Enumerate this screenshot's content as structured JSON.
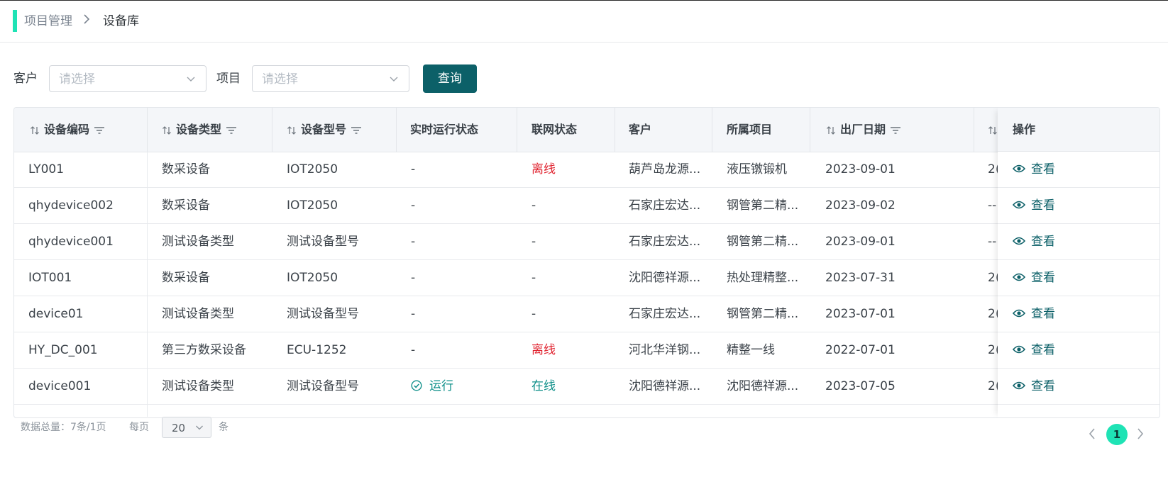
{
  "breadcrumb": {
    "parent": "项目管理",
    "separator": "›",
    "current": "设备库"
  },
  "filters": {
    "customer_label": "客户",
    "customer_placeholder": "请选择",
    "project_label": "项目",
    "project_placeholder": "请选择",
    "query_button": "查询"
  },
  "table": {
    "headers": {
      "code": "设备编码",
      "type": "设备类型",
      "model": "设备型号",
      "run_status": "实时运行状态",
      "net_status": "联网状态",
      "customer": "客户",
      "project": "所属项目",
      "factory_date": "出厂日期",
      "actions": "操作"
    },
    "view_label": "查看",
    "rows": [
      {
        "code": "LY001",
        "type": "数采设备",
        "model": "IOT2050",
        "run": "-",
        "net": "离线",
        "customer": "葫芦岛龙源...",
        "project": "液压镦锻机",
        "date": "2023-09-01",
        "extra": "2("
      },
      {
        "code": "qhydevice002",
        "type": "数采设备",
        "model": "IOT2050",
        "run": "-",
        "net": "-",
        "customer": "石家庄宏达...",
        "project": "钢管第二精...",
        "date": "2023-09-02",
        "extra": "--"
      },
      {
        "code": "qhydevice001",
        "type": "测试设备类型",
        "model": "测试设备型号",
        "run": "-",
        "net": "-",
        "customer": "石家庄宏达...",
        "project": "钢管第二精...",
        "date": "2023-09-01",
        "extra": "--"
      },
      {
        "code": "IOT001",
        "type": "数采设备",
        "model": "IOT2050",
        "run": "-",
        "net": "-",
        "customer": "沈阳德祥源...",
        "project": "热处理精整...",
        "date": "2023-07-31",
        "extra": "2("
      },
      {
        "code": "device01",
        "type": "测试设备类型",
        "model": "测试设备型号",
        "run": "-",
        "net": "-",
        "customer": "石家庄宏达...",
        "project": "钢管第二精...",
        "date": "2023-07-01",
        "extra": "2("
      },
      {
        "code": "HY_DC_001",
        "type": "第三方数采设备",
        "model": "ECU-1252",
        "run": "-",
        "net": "离线",
        "customer": "河北华洋钢...",
        "project": "精整一线",
        "date": "2022-07-01",
        "extra": "2("
      },
      {
        "code": "device001",
        "type": "测试设备类型",
        "model": "测试设备型号",
        "run": "运行",
        "net": "在线",
        "customer": "沈阳德祥源...",
        "project": "沈阳德祥源...",
        "date": "2023-07-05",
        "extra": "2("
      }
    ]
  },
  "pagination": {
    "total_text": "数据总量：7条/1页",
    "per_page_label": "每页",
    "page_size": "20",
    "unit_label": "条",
    "current_page": "1"
  },
  "colors": {
    "accent": "#1fe3b5",
    "primary": "#0c6068",
    "danger": "#e0222e",
    "success": "#10908a"
  }
}
